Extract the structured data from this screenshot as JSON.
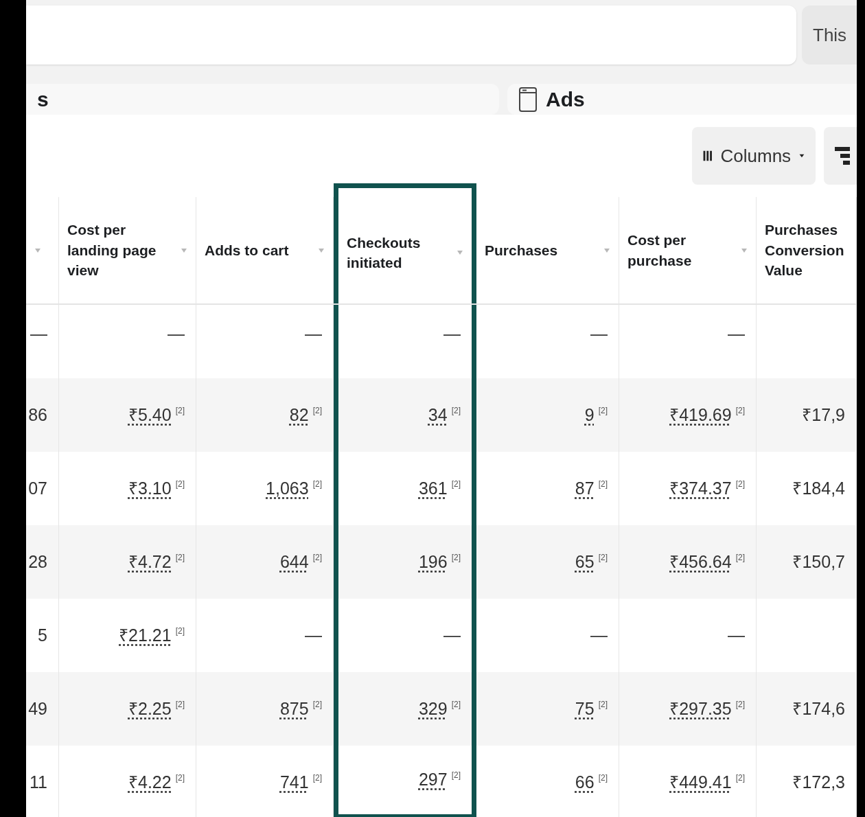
{
  "date_button": {
    "label": "This"
  },
  "tabs": [
    {
      "label": "s",
      "icon": false
    },
    {
      "label": "Ads",
      "icon": true
    }
  ],
  "toolbar": {
    "columns_button": "Columns"
  },
  "table": {
    "columns": [
      {
        "sort_arrow": true,
        "highlighted": false
      },
      {
        "label": "Cost per landing page view",
        "sort_arrow": true,
        "highlighted": false
      },
      {
        "label": "Adds to cart",
        "sort_arrow": true,
        "highlighted": false
      },
      {
        "label": "Checkouts initiated",
        "sort_arrow": true,
        "highlighted": true
      },
      {
        "label": "Purchases",
        "sort_arrow": true,
        "highlighted": false
      },
      {
        "label": "Cost per purchase",
        "sort_arrow": true,
        "highlighted": false
      },
      {
        "label": "Purchases Conversion Value",
        "sort_arrow": false,
        "highlighted": false
      }
    ],
    "rows": [
      {
        "cells": [
          {
            "value": "—"
          },
          {
            "value": "—"
          },
          {
            "value": "—"
          },
          {
            "value": "—"
          },
          {
            "value": "—"
          },
          {
            "value": "—"
          },
          {}
        ]
      },
      {
        "cells": [
          {
            "value": "86"
          },
          {
            "value": "₹5.40",
            "note": "[2]"
          },
          {
            "value": "82",
            "note": "[2]"
          },
          {
            "value": "34",
            "note": "[2]"
          },
          {
            "value": "9",
            "note": "[2]"
          },
          {
            "value": "₹419.69",
            "note": "[2]"
          },
          {
            "value": "₹17,9"
          }
        ]
      },
      {
        "cells": [
          {
            "value": "07"
          },
          {
            "value": "₹3.10",
            "note": "[2]"
          },
          {
            "value": "1,063",
            "note": "[2]"
          },
          {
            "value": "361",
            "note": "[2]"
          },
          {
            "value": "87",
            "note": "[2]"
          },
          {
            "value": "₹374.37",
            "note": "[2]"
          },
          {
            "value": "₹184,4"
          }
        ]
      },
      {
        "cells": [
          {
            "value": "28"
          },
          {
            "value": "₹4.72",
            "note": "[2]"
          },
          {
            "value": "644",
            "note": "[2]"
          },
          {
            "value": "196",
            "note": "[2]"
          },
          {
            "value": "65",
            "note": "[2]"
          },
          {
            "value": "₹456.64",
            "note": "[2]"
          },
          {
            "value": "₹150,7"
          }
        ]
      },
      {
        "cells": [
          {
            "value": "5"
          },
          {
            "value": "₹21.21",
            "note": "[2]"
          },
          {
            "value": "—"
          },
          {
            "value": "—"
          },
          {
            "value": "—"
          },
          {
            "value": "—"
          },
          {}
        ]
      },
      {
        "cells": [
          {
            "value": "49"
          },
          {
            "value": "₹2.25",
            "note": "[2]"
          },
          {
            "value": "875",
            "note": "[2]"
          },
          {
            "value": "329",
            "note": "[2]"
          },
          {
            "value": "75",
            "note": "[2]"
          },
          {
            "value": "₹297.35",
            "note": "[2]"
          },
          {
            "value": "₹174,6"
          }
        ]
      },
      {
        "cells": [
          {
            "value": "11"
          },
          {
            "value": "₹4.22",
            "note": "[2]"
          },
          {
            "value": "741",
            "note": "[2]"
          },
          {
            "value": "297",
            "note": "[2]"
          },
          {
            "value": "66",
            "note": "[2]"
          },
          {
            "value": "₹449.41",
            "note": "[2]"
          },
          {
            "value": "₹172,3"
          }
        ]
      }
    ]
  }
}
